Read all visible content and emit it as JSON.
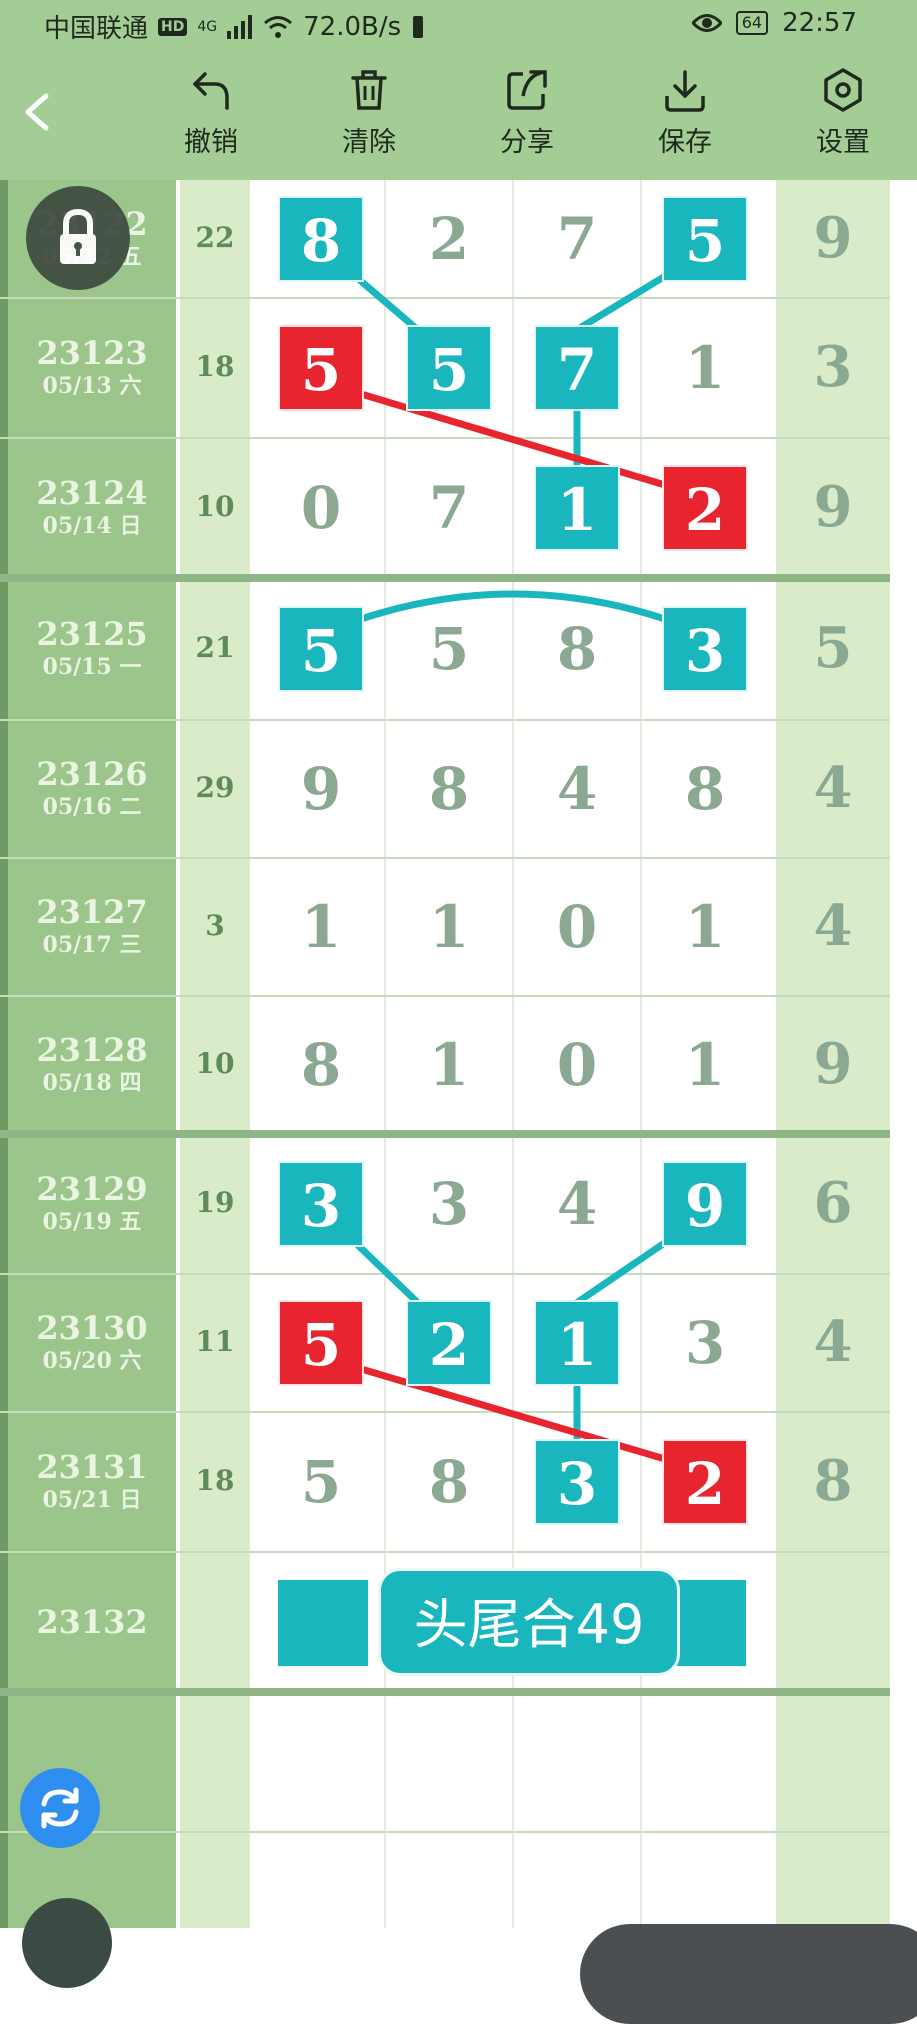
{
  "status": {
    "carrier": "中国联通",
    "hd": "HD",
    "net": "4G",
    "speed": "72.0B/s",
    "battery": "64",
    "time": "22:57"
  },
  "toolbar": {
    "undo": "撤销",
    "clear": "清除",
    "share": "分享",
    "save": "保存",
    "settings": "设置"
  },
  "rows": [
    {
      "issue": "23122",
      "date": "05/12 五",
      "sum": "22",
      "digits": [
        "8",
        "2",
        "7",
        "5"
      ],
      "tail": "9"
    },
    {
      "issue": "23123",
      "date": "05/13 六",
      "sum": "18",
      "digits": [
        "5",
        "5",
        "7",
        "1"
      ],
      "tail": "3"
    },
    {
      "issue": "23124",
      "date": "05/14 日",
      "sum": "10",
      "digits": [
        "0",
        "7",
        "1",
        "2"
      ],
      "tail": "9"
    },
    {
      "issue": "23125",
      "date": "05/15 一",
      "sum": "21",
      "digits": [
        "5",
        "5",
        "8",
        "3"
      ],
      "tail": "5"
    },
    {
      "issue": "23126",
      "date": "05/16 二",
      "sum": "29",
      "digits": [
        "9",
        "8",
        "4",
        "8"
      ],
      "tail": "4"
    },
    {
      "issue": "23127",
      "date": "05/17 三",
      "sum": "3",
      "digits": [
        "1",
        "1",
        "0",
        "1"
      ],
      "tail": "4"
    },
    {
      "issue": "23128",
      "date": "05/18 四",
      "sum": "10",
      "digits": [
        "8",
        "1",
        "0",
        "1"
      ],
      "tail": "9"
    },
    {
      "issue": "23129",
      "date": "05/19 五",
      "sum": "19",
      "digits": [
        "3",
        "3",
        "4",
        "9"
      ],
      "tail": "6"
    },
    {
      "issue": "23130",
      "date": "05/20 六",
      "sum": "11",
      "digits": [
        "5",
        "2",
        "1",
        "3"
      ],
      "tail": "4"
    },
    {
      "issue": "23131",
      "date": "05/21 日",
      "sum": "18",
      "digits": [
        "5",
        "8",
        "3",
        "2"
      ],
      "tail": "8"
    },
    {
      "issue": "23132",
      "date": "",
      "sum": "",
      "digits": [
        "",
        "",
        "",
        ""
      ],
      "tail": ""
    }
  ],
  "highlights": {
    "teal": [
      [
        0,
        0
      ],
      [
        0,
        3
      ],
      [
        1,
        1
      ],
      [
        1,
        2
      ],
      [
        2,
        2
      ],
      [
        3,
        0
      ],
      [
        3,
        3
      ],
      [
        7,
        0
      ],
      [
        7,
        3
      ],
      [
        8,
        1
      ],
      [
        8,
        2
      ],
      [
        9,
        2
      ]
    ],
    "red": [
      [
        1,
        0
      ],
      [
        2,
        3
      ],
      [
        8,
        0
      ],
      [
        9,
        3
      ]
    ]
  },
  "tag_text": "头尾合49",
  "colors": {
    "teal": "#19b6bd",
    "red": "#e8242f",
    "header": "#a4cd95",
    "sidebar": "#9bc58a"
  }
}
